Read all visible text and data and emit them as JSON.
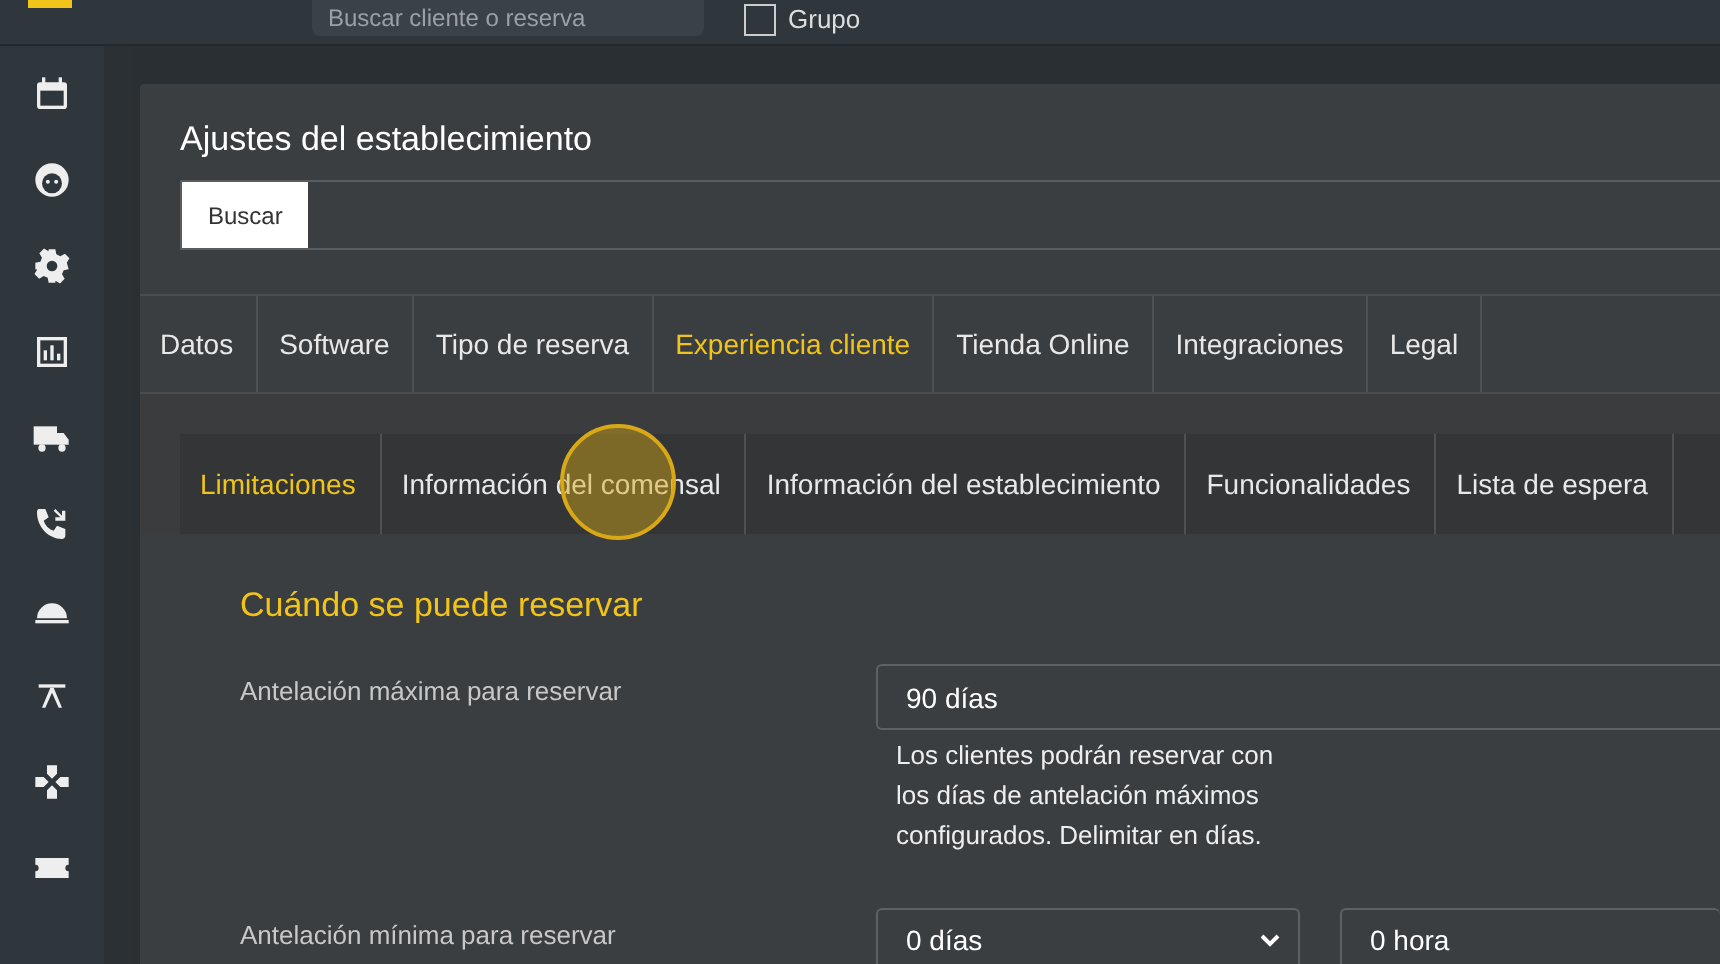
{
  "top_bar": {
    "search": {
      "placeholder": "Buscar cliente o reserva"
    },
    "group": {
      "label": "Grupo",
      "checked": false
    }
  },
  "sidebar": {
    "items": [
      {
        "kind": "calendar"
      },
      {
        "kind": "face"
      },
      {
        "kind": "gear"
      },
      {
        "kind": "chart"
      },
      {
        "kind": "truck"
      },
      {
        "kind": "phone"
      },
      {
        "kind": "cloche"
      },
      {
        "kind": "table"
      },
      {
        "kind": "gamepad"
      },
      {
        "kind": "ticket"
      }
    ]
  },
  "panel": {
    "title": "Ajustes del establecimiento",
    "search_button": "Buscar",
    "tabs": [
      {
        "label": "Datos",
        "selected": false
      },
      {
        "label": "Software",
        "selected": false
      },
      {
        "label": "Tipo de reserva",
        "selected": false
      },
      {
        "label": "Experiencia cliente",
        "selected": true
      },
      {
        "label": "Tienda Online",
        "selected": false
      },
      {
        "label": "Integraciones",
        "selected": false
      },
      {
        "label": "Legal",
        "selected": false
      }
    ],
    "subtabs": [
      {
        "label": "Limitaciones",
        "selected": true
      },
      {
        "label": "Información del comensal",
        "selected": false
      },
      {
        "label": "Información del establecimiento",
        "selected": false
      },
      {
        "label": "Funcionalidades",
        "selected": false
      },
      {
        "label": "Lista de espera",
        "selected": false
      }
    ],
    "section": {
      "heading": "Cuándo se puede reservar",
      "rows": [
        {
          "kind": "input",
          "label": "Antelación máxima para reservar",
          "value": "90 días",
          "help": "Los clientes podrán reservar con los días de antelación máximos configurados. Delimitar en días."
        },
        {
          "kind": "selects",
          "label": "Antelación mínima para reservar",
          "value": "0 días",
          "value_2": "0 hora"
        }
      ]
    }
  }
}
